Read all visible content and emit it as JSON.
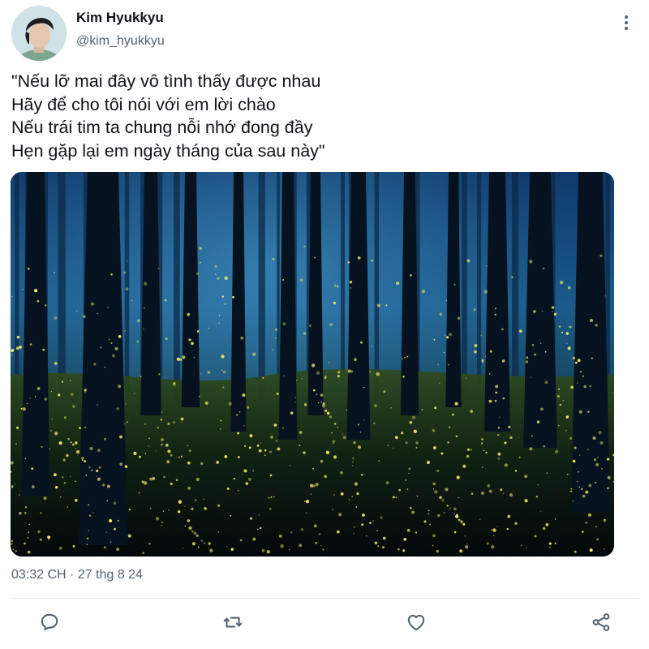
{
  "tweet": {
    "author": {
      "display_name": "Kim Hyukkyu",
      "handle": "@kim_hyukkyu"
    },
    "text_lines": [
      "\"Nếu lỡ mai đây vô tình thấy được nhau",
      "Hãy để cho tôi nói với em lời chào",
      "Nếu trái tim ta chung nỗi nhớ đong đầy",
      "Hẹn gặp lại em ngày tháng của sau này\""
    ],
    "media": {
      "subject": "firefly-forest-photo"
    },
    "timestamp": "03:32 CH · 27 thg 8 24"
  },
  "icons": {
    "more": "more-vertical-icon",
    "reply": "reply-icon",
    "retweet": "retweet-icon",
    "like": "heart-icon",
    "share": "share-icon"
  },
  "colors": {
    "text_primary": "#0f1419",
    "text_secondary": "#536471",
    "divider": "#e6ecf0"
  }
}
